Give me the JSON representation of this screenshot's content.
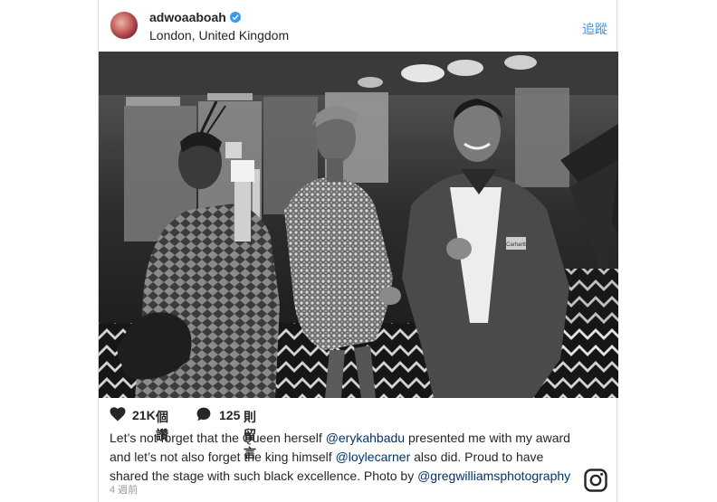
{
  "post": {
    "username": "adwoaaboah",
    "location": "London, United Kingdom",
    "follow_label": "追蹤",
    "likes_count": "21K",
    "likes_unit": "個讚",
    "comments_count": "125",
    "comments_unit": "則留言",
    "caption": {
      "p1": "Let’s not forget that the Queen herself ",
      "m1": "@erykahbadu",
      "p2": " presented me with my award and let’s not also forget the king himself ",
      "m2": "@loylecarner",
      "p3": " also did. Proud to have shared the stage with such black excellence. Photo by ",
      "m3": "@gregwilliamsphotography"
    },
    "timestamp": "4 週前",
    "photo_text": "Carhartt"
  },
  "colors": {
    "link": "#3897f0",
    "mention": "#003569",
    "verified": "#3897f0",
    "text": "#262626",
    "muted": "#999999"
  },
  "icons": [
    "verified-badge-icon",
    "heart-icon",
    "comment-icon",
    "instagram-logo-icon"
  ]
}
